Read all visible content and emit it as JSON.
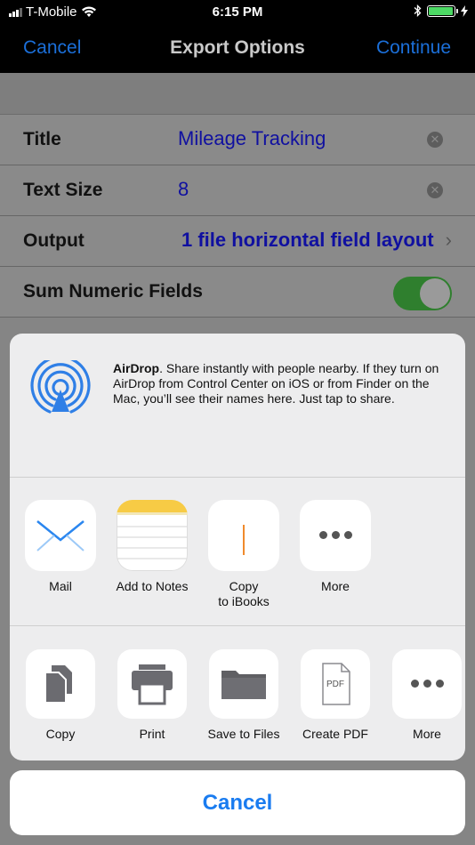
{
  "status": {
    "carrier": "T-Mobile",
    "time": "6:15 PM"
  },
  "nav": {
    "cancel": "Cancel",
    "title": "Export Options",
    "continue": "Continue"
  },
  "form": {
    "rows": [
      {
        "label": "Title",
        "value": "Mileage Tracking"
      },
      {
        "label": "Text Size",
        "value": "8"
      },
      {
        "label": "Output",
        "value": "1 file horizontal field layout"
      },
      {
        "label": "Sum Numeric Fields"
      }
    ]
  },
  "airdrop": {
    "title": "AirDrop",
    "text": ". Share instantly with people nearby. If they turn on AirDrop from Control Center on iOS or from Finder on the Mac, you’ll see their names here. Just tap to share."
  },
  "apps": [
    {
      "label": "Mail",
      "icon": "mail-icon"
    },
    {
      "label": "Add to Notes",
      "icon": "notes-icon"
    },
    {
      "label": "Copy\nto iBooks",
      "icon": "ibooks-icon"
    },
    {
      "label": "More",
      "icon": "more-icon"
    }
  ],
  "actions": [
    {
      "label": "Copy",
      "icon": "copy-icon"
    },
    {
      "label": "Print",
      "icon": "print-icon"
    },
    {
      "label": "Save to Files",
      "icon": "folder-icon"
    },
    {
      "label": "Create PDF",
      "icon": "pdf-icon",
      "badge": "PDF"
    },
    {
      "label": "More",
      "icon": "more-icon"
    }
  ],
  "cancel": "Cancel",
  "colors": {
    "accent": "#1a7cf0",
    "switch_on": "#4cd964",
    "value_text": "#1010a0"
  }
}
